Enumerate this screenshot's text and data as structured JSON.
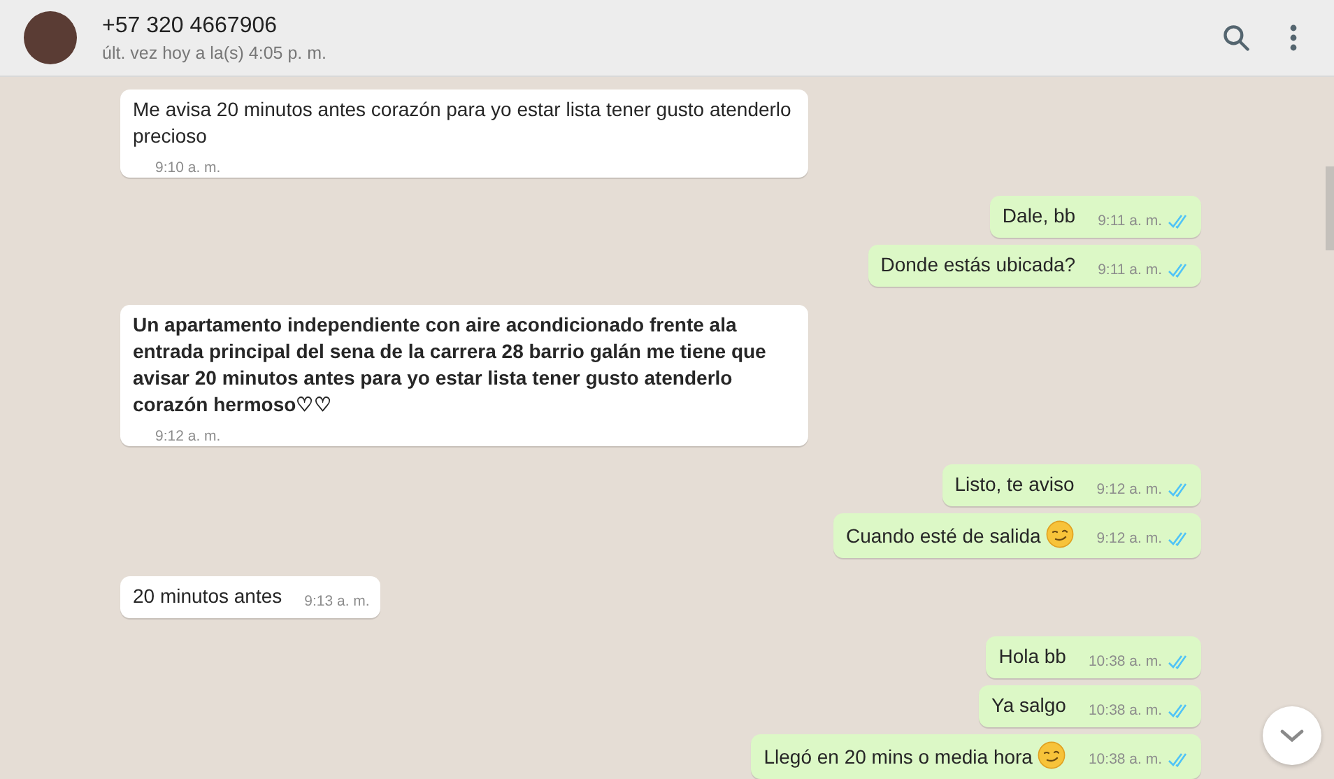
{
  "header": {
    "name": "+57 320 4667906",
    "status": "últ. vez hoy a la(s) 4:05 p. m."
  },
  "messages": [
    {
      "outgoing": false,
      "text": "Me avisa 20 minutos antes corazón para yo estar lista tener gusto atenderlo precioso",
      "time": "9:10 a. m.",
      "bold": false,
      "emoji": false
    },
    {
      "outgoing": true,
      "text": "Dale, bb",
      "time": "9:11 a. m.",
      "read": true,
      "bold": false,
      "emoji": false
    },
    {
      "outgoing": true,
      "text": "Donde estás ubicada?",
      "time": "9:11 a. m.",
      "read": true,
      "bold": false,
      "emoji": false
    },
    {
      "outgoing": false,
      "text": "Un apartamento independiente con aire acondicionado frente ala entrada principal del sena  de la carrera 28 barrio galán me tiene que avisar 20 minutos antes para yo estar lista tener gusto atenderlo corazón hermoso♡♡",
      "time": "9:12 a. m.",
      "bold": true,
      "emoji": false
    },
    {
      "outgoing": true,
      "text": "Listo, te aviso",
      "time": "9:12 a. m.",
      "read": true,
      "bold": false,
      "emoji": false
    },
    {
      "outgoing": true,
      "text": "Cuando esté de salida",
      "time": "9:12 a. m.",
      "read": true,
      "bold": false,
      "emoji": true
    },
    {
      "outgoing": false,
      "text": "20 minutos antes",
      "time": "9:13 a. m.",
      "bold": false,
      "emoji": false
    },
    {
      "outgoing": true,
      "text": "Hola bb",
      "time": "10:38 a. m.",
      "read": true,
      "bold": false,
      "emoji": false
    },
    {
      "outgoing": true,
      "text": "Ya salgo",
      "time": "10:38 a. m.",
      "read": true,
      "bold": false,
      "emoji": false
    },
    {
      "outgoing": true,
      "text": "Llegó en 20 mins o media hora",
      "time": "10:38 a. m.",
      "read": true,
      "bold": false,
      "emoji": true
    }
  ]
}
